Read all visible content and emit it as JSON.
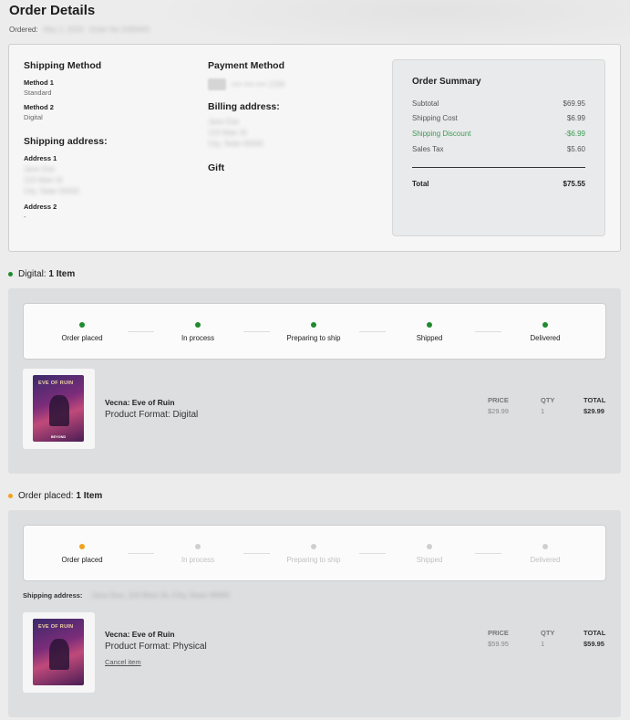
{
  "page": {
    "title": "Order Details",
    "ordered_label": "Ordered:",
    "ordered_value": "May 1, 2024",
    "order_no": "Order No 2089493"
  },
  "shipping": {
    "heading": "Shipping Method",
    "methods": [
      {
        "label": "Method 1",
        "value": "Standard"
      },
      {
        "label": "Method 2",
        "value": "Digital"
      }
    ],
    "address_heading": "Shipping address:",
    "address1_label": "Address 1",
    "address1_lines": [
      "Jane Doe",
      "123 Main St",
      "City, State 00000"
    ],
    "address2_label": "Address 2",
    "address2_value": "-"
  },
  "payment": {
    "heading": "Payment Method",
    "card_text": "•••• •••• •••• 1234",
    "billing_heading": "Billing address:",
    "billing_lines": [
      "Jane Doe",
      "123 Main St",
      "City, State 00000"
    ],
    "gift_heading": "Gift"
  },
  "summary": {
    "title": "Order Summary",
    "rows": [
      {
        "label": "Subtotal",
        "value": "$69.95"
      },
      {
        "label": "Shipping Cost",
        "value": "$6.99"
      },
      {
        "label": "Shipping Discount",
        "value": "-$6.99"
      },
      {
        "label": "Sales Tax",
        "value": "$5.60"
      }
    ],
    "total_label": "Total",
    "total_value": "$75.55"
  },
  "groups": [
    {
      "status": "Digital:",
      "count": "1 Item",
      "dot_color": "#1f8a2e",
      "steps": [
        "Order placed",
        "In process",
        "Preparing to ship",
        "Shipped",
        "Delivered"
      ],
      "active_steps": 5,
      "item": {
        "name": "Vecna: Eve of Ruin",
        "format": "Product Format: Digital",
        "price_label": "PRICE",
        "qty_label": "QTY",
        "total_label": "TOTAL",
        "price": "$29.99",
        "qty": "1",
        "total": "$29.99",
        "cover_title": "EVE OF RUIN",
        "cover_brand": "BEYOND"
      }
    },
    {
      "status": "Order placed:",
      "count": "1 Item",
      "dot_color": "#f0a21c",
      "steps": [
        "Order placed",
        "In process",
        "Preparing to ship",
        "Shipped",
        "Delivered"
      ],
      "active_steps": 1,
      "shipping_label": "Shipping address:",
      "shipping_value": "Jane Doe, 123 Main St, City, State 00000",
      "item": {
        "name": "Vecna: Eve of Ruin",
        "format": "Product Format: Physical",
        "cancel": "Cancel item",
        "price_label": "PRICE",
        "qty_label": "QTY",
        "total_label": "TOTAL",
        "price": "$59.95",
        "qty": "1",
        "total": "$59.95",
        "cover_title": "EVE OF RUIN",
        "cover_brand": ""
      }
    }
  ],
  "colors": {
    "active_dot": "#1f8a2e",
    "pending_dot": "#f0a21c",
    "inactive_dot": "#c9c9c9",
    "discount": "#3d9a55"
  }
}
